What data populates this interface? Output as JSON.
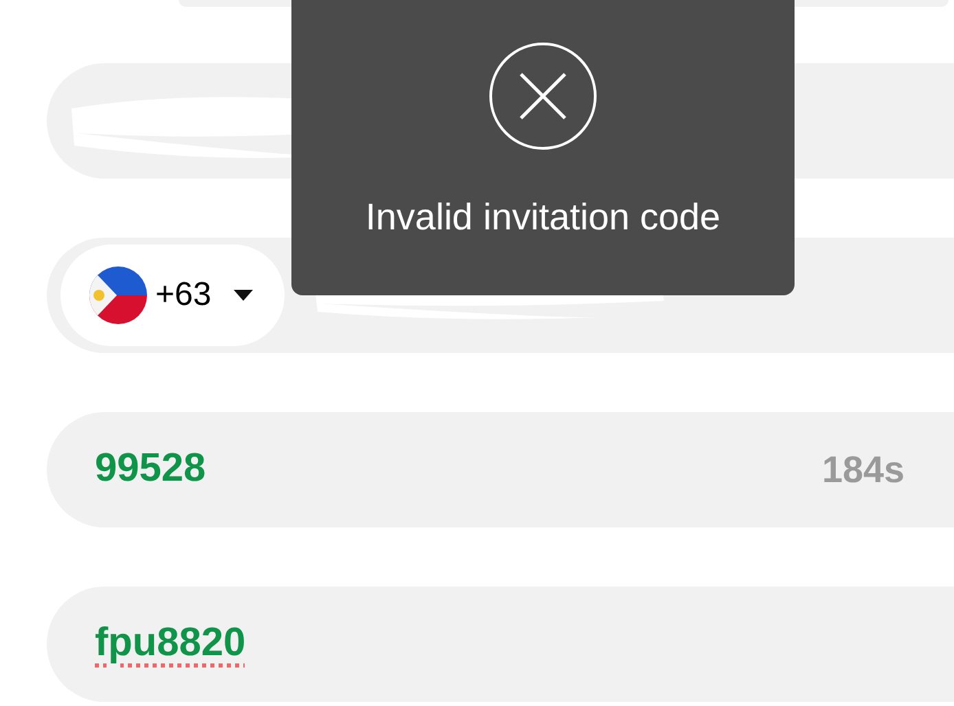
{
  "fields": [
    {
      "kind": "redacted"
    },
    {
      "kind": "phone",
      "country_code": "+63"
    },
    {
      "kind": "code",
      "value": "99528",
      "countdown": "184s",
      "misspelled": false
    },
    {
      "kind": "code",
      "value": "fpu8820",
      "misspelled": true
    }
  ],
  "toast": {
    "message": "Invalid invitation code"
  }
}
